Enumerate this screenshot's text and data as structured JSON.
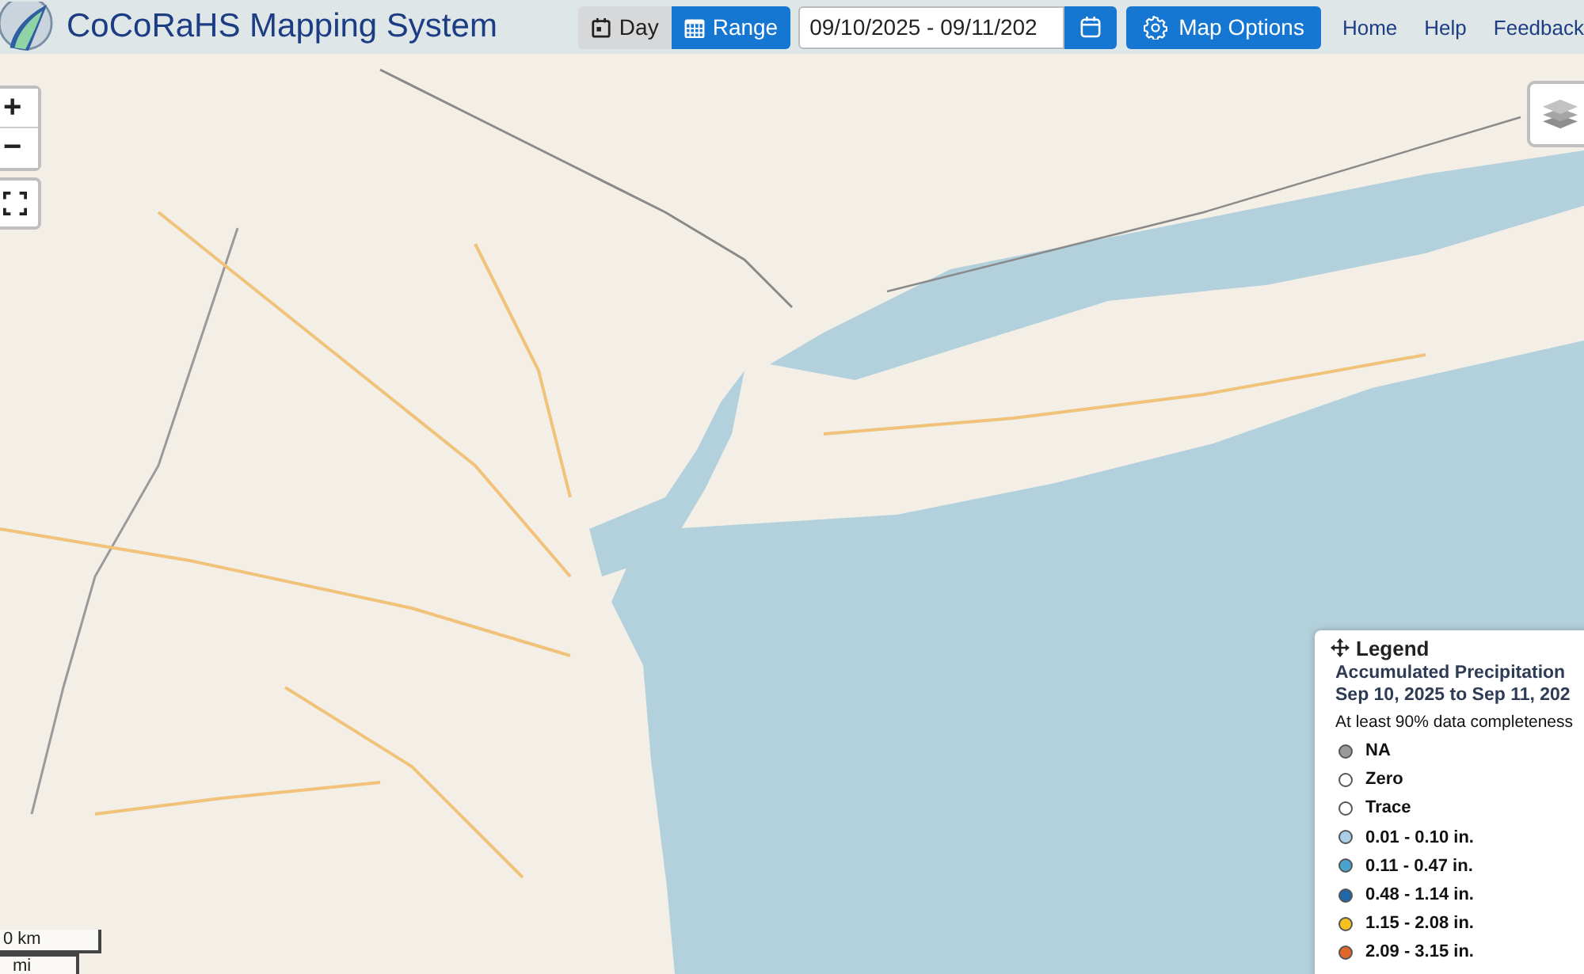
{
  "header": {
    "title": "CoCoRaHS Mapping System",
    "view_toggle": [
      {
        "label": "Day",
        "kind": "day",
        "selected": false
      },
      {
        "label": "Range",
        "kind": "range",
        "selected": true
      }
    ],
    "date_range": {
      "value": "09/10/2025 - 09/11/202"
    },
    "map_options_button": "Map Options",
    "nav_links": [
      "Home",
      "Help",
      "Feedback"
    ]
  },
  "map": {
    "zoom_in": "+",
    "zoom_out": "−",
    "scale": {
      "km": "0 km",
      "mi": "mi"
    },
    "legend": {
      "heading": "Legend",
      "title": "Accumulated Precipitation",
      "period": "Sep 10, 2025 to Sep 11, 202",
      "note": "At least 90% data completeness",
      "items": [
        {
          "label": "NA",
          "color": "#999999"
        },
        {
          "label": "Zero",
          "color": "#ffffff"
        },
        {
          "label": "Trace",
          "color": "#ffffff"
        },
        {
          "label": "0.01 - 0.10 in.",
          "color": "#a9cfe6"
        },
        {
          "label": "0.11 - 0.47 in.",
          "color": "#4aa3cf"
        },
        {
          "label": "0.48 - 1.14 in.",
          "color": "#1f67a8"
        },
        {
          "label": "1.15 - 2.08 in.",
          "color": "#f5c020"
        },
        {
          "label": "2.09 - 3.15 in.",
          "color": "#e0662a"
        }
      ]
    }
  }
}
